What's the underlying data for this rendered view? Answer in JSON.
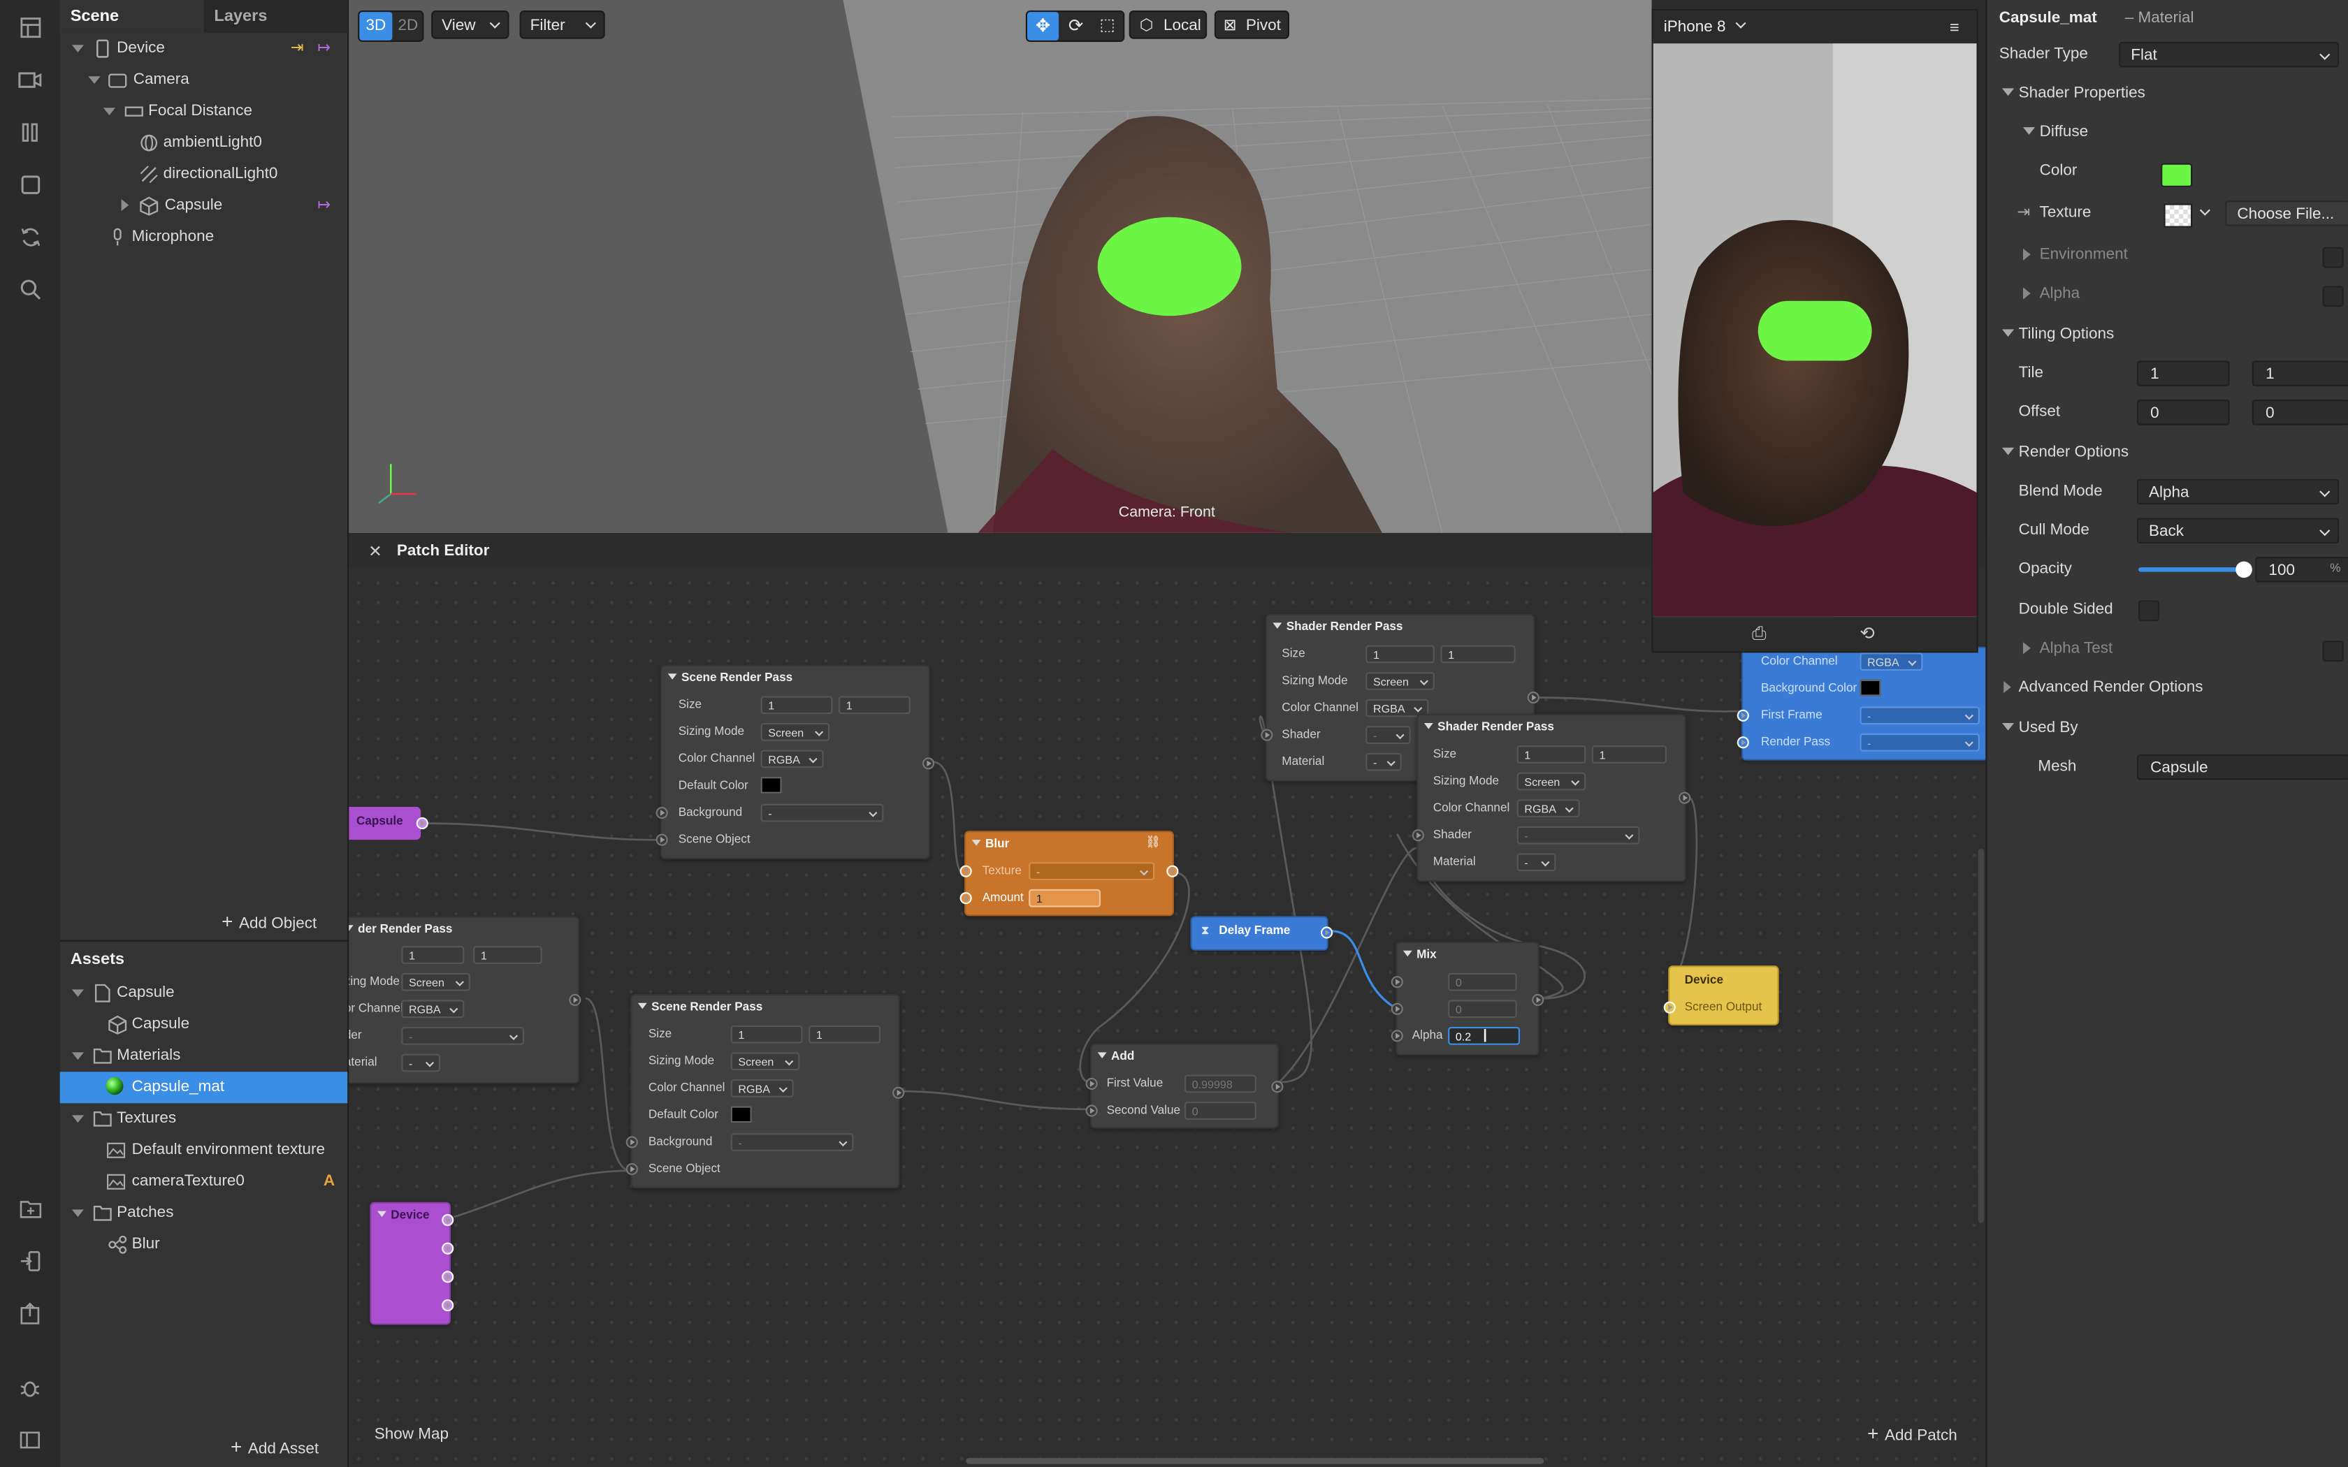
{
  "colors": {
    "accent": "#3a8ee6",
    "green": "#6cf545",
    "purple": "#a94fd0",
    "orange": "#c8752b",
    "yellow": "#e6c34b",
    "blue": "#3a7bd5"
  },
  "scene": {
    "tabs": [
      "Scene",
      "Layers"
    ],
    "tree": [
      "Device",
      "Camera",
      "Focal Distance",
      "ambientLight0",
      "directionalLight0",
      "Capsule",
      "Microphone"
    ],
    "add_object": "Add Object"
  },
  "assets": {
    "title": "Assets",
    "tree": [
      "Capsule",
      "Capsule",
      "Materials",
      "Capsule_mat",
      "Textures",
      "Default environment texture",
      "cameraTexture0",
      "Patches",
      "Blur"
    ],
    "badge": "A",
    "add_asset": "Add Asset"
  },
  "viewport": {
    "mode_3d": "3D",
    "mode_2d": "2D",
    "view": "View",
    "filter": "Filter",
    "local": "Local",
    "pivot": "Pivot",
    "camera_label": "Camera: Front"
  },
  "simulator": {
    "device": "iPhone 8"
  },
  "patch": {
    "title": "Patch Editor",
    "show_map": "Show Map",
    "add_patch": "Add Patch",
    "srp1": {
      "title": "Scene Render Pass",
      "size": "Size",
      "w": "1",
      "h": "1",
      "sizing": "Sizing Mode",
      "sizing_val": "Screen",
      "channel": "Color Channel",
      "channel_val": "RGBA",
      "default_color": "Default Color",
      "background": "Background",
      "bg_val": "-",
      "scene_object": "Scene Object"
    },
    "srp2": {
      "title": "Scene Render Pass",
      "size": "Size",
      "w": "1",
      "h": "1",
      "sizing": "Sizing Mode",
      "sizing_val": "Screen",
      "channel": "Color Channel",
      "channel_val": "RGBA",
      "default_color": "Default Color",
      "background": "Background",
      "bg_val": "-",
      "scene_object": "Scene Object"
    },
    "srp3": {
      "title": "der Render Pass",
      "w": "1",
      "h": "1",
      "sizing": "zing Mode",
      "sizing_val": "Screen",
      "channel": "or Channel",
      "channel_val": "RGBA",
      "shader": "der",
      "material": "aterial",
      "dash": "-"
    },
    "capsule": "Capsule",
    "blur": {
      "title": "Blur",
      "texture": "Texture",
      "amount": "Amount",
      "amount_val": "1",
      "dash": "-"
    },
    "shader1": {
      "title": "Shader Render Pass",
      "size": "Size",
      "w": "1",
      "h": "1",
      "sizing": "Sizing Mode",
      "sizing_val": "Screen",
      "channel": "Color Channel",
      "channel_val": "RGBA",
      "shader": "Shader",
      "material": "Material",
      "dash": "-"
    },
    "shader2": {
      "title": "Shader Render Pass",
      "size": "Size",
      "w": "1",
      "h": "1",
      "sizing": "Sizing Mode",
      "sizing_val": "Screen",
      "channel": "Color Channel",
      "channel_val": "RGBA",
      "shader": "Shader",
      "material": "Material",
      "dash": "-"
    },
    "delay": "Delay Frame",
    "mix": {
      "title": "Mix",
      "a": "0",
      "b": "0",
      "alpha": "Alpha",
      "alpha_val": "0.2"
    },
    "add": {
      "title": "Add",
      "first": "First Value",
      "first_val": "0.99998",
      "second": "Second Value",
      "second_val": "0"
    },
    "device_out": {
      "title": "Device",
      "port": "Screen Output"
    },
    "device_src": "Device",
    "blue_node": {
      "channel": "Color Channel",
      "channel_val": "RGBA",
      "bg": "Background Color",
      "first_frame": "First Frame",
      "render_pass": "Render Pass",
      "dash": "-"
    }
  },
  "inspector": {
    "title": "Capsule_mat",
    "subtitle": "– Material",
    "shader_type": "Shader Type",
    "shader_type_val": "Flat",
    "shader_props": "Shader Properties",
    "diffuse": "Diffuse",
    "color": "Color",
    "texture": "Texture",
    "choose_file": "Choose File...",
    "environment": "Environment",
    "alpha": "Alpha",
    "tiling": "Tiling Options",
    "tile": "Tile",
    "tile_x": "1",
    "tile_y": "1",
    "offset": "Offset",
    "offset_x": "0",
    "offset_y": "0",
    "render_options": "Render Options",
    "blend_mode": "Blend Mode",
    "blend_val": "Alpha",
    "cull_mode": "Cull Mode",
    "cull_val": "Back",
    "opacity": "Opacity",
    "opacity_val": "100",
    "opacity_unit": "%",
    "opacity_level": 1.0,
    "double_sided": "Double Sided",
    "alpha_test": "Alpha Test",
    "advanced": "Advanced Render Options",
    "used_by": "Used By",
    "mesh": "Mesh",
    "mesh_val": "Capsule"
  }
}
